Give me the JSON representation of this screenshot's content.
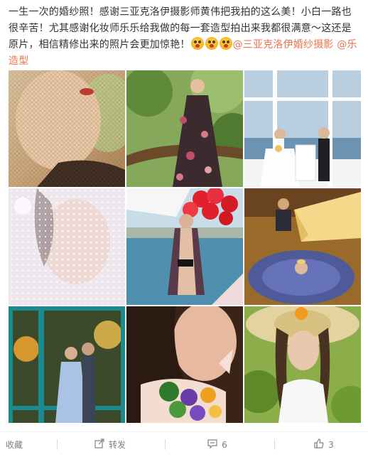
{
  "post": {
    "text_before": "一生一次的婚纱照！感谢三亚克洛伊摄影师黄伟把我拍的这么美！小白一路也很辛苦！尤其感谢化妆师乐乐给我做的每一套造型拍出来我都很满意～这还是原片，相信精修出来的照片会更加惊艳！",
    "emoji_name": "surprised-face-emoji",
    "mentions": [
      "@三亚克洛伊婚纱摄影",
      "@乐造型"
    ]
  },
  "photos": [
    {
      "subject": "bride in veil close-up"
    },
    {
      "subject": "bride in floral dress by tree"
    },
    {
      "subject": "couple at white altar by sea"
    },
    {
      "subject": "bride under lace veil"
    },
    {
      "subject": "woman in swimsuit with red balloons"
    },
    {
      "subject": "bride in blue gown by piano"
    },
    {
      "subject": "couple behind teal door"
    },
    {
      "subject": "woman with flower bouquet"
    },
    {
      "subject": "woman in straw hat"
    }
  ],
  "actions": {
    "favorite_label": "收藏",
    "repost_label": "转发",
    "comment_count": "6",
    "like_count": "3"
  },
  "colors": {
    "mention": "#eb7350",
    "text": "#333333",
    "action_text": "#808080"
  }
}
